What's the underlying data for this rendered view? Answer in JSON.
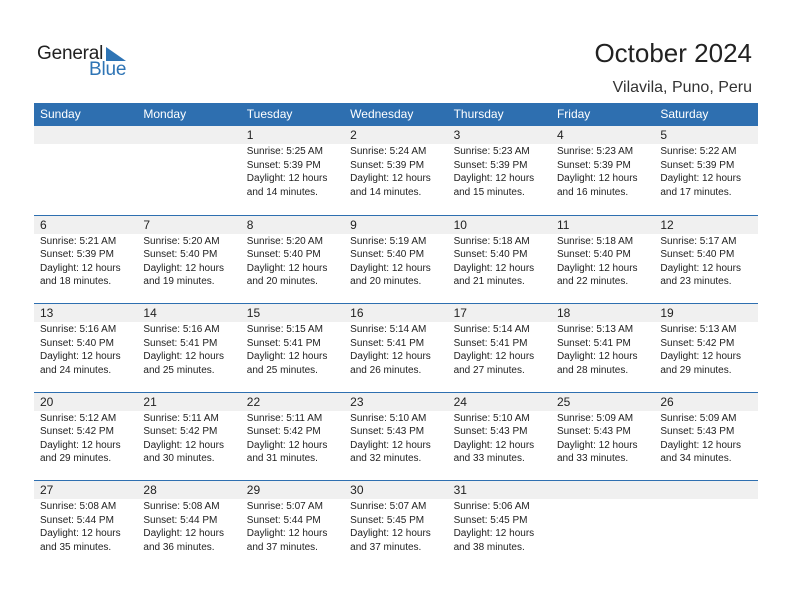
{
  "logo": {
    "line1": "General",
    "line2": "Blue",
    "icon": "triangle-flag-icon",
    "accent_color": "#2e74b5"
  },
  "header": {
    "title": "October 2024",
    "location": "Vilavila, Puno, Peru"
  },
  "colors": {
    "header_bg": "#2e6fb0",
    "day_num_bg": "#f0f0f0"
  },
  "weekdays": [
    "Sunday",
    "Monday",
    "Tuesday",
    "Wednesday",
    "Thursday",
    "Friday",
    "Saturday"
  ],
  "weeks": [
    [
      null,
      null,
      {
        "day": "1",
        "sunrise": "Sunrise: 5:25 AM",
        "sunset": "Sunset: 5:39 PM",
        "daylight1": "Daylight: 12 hours",
        "daylight2": "and 14 minutes."
      },
      {
        "day": "2",
        "sunrise": "Sunrise: 5:24 AM",
        "sunset": "Sunset: 5:39 PM",
        "daylight1": "Daylight: 12 hours",
        "daylight2": "and 14 minutes."
      },
      {
        "day": "3",
        "sunrise": "Sunrise: 5:23 AM",
        "sunset": "Sunset: 5:39 PM",
        "daylight1": "Daylight: 12 hours",
        "daylight2": "and 15 minutes."
      },
      {
        "day": "4",
        "sunrise": "Sunrise: 5:23 AM",
        "sunset": "Sunset: 5:39 PM",
        "daylight1": "Daylight: 12 hours",
        "daylight2": "and 16 minutes."
      },
      {
        "day": "5",
        "sunrise": "Sunrise: 5:22 AM",
        "sunset": "Sunset: 5:39 PM",
        "daylight1": "Daylight: 12 hours",
        "daylight2": "and 17 minutes."
      }
    ],
    [
      {
        "day": "6",
        "sunrise": "Sunrise: 5:21 AM",
        "sunset": "Sunset: 5:39 PM",
        "daylight1": "Daylight: 12 hours",
        "daylight2": "and 18 minutes."
      },
      {
        "day": "7",
        "sunrise": "Sunrise: 5:20 AM",
        "sunset": "Sunset: 5:40 PM",
        "daylight1": "Daylight: 12 hours",
        "daylight2": "and 19 minutes."
      },
      {
        "day": "8",
        "sunrise": "Sunrise: 5:20 AM",
        "sunset": "Sunset: 5:40 PM",
        "daylight1": "Daylight: 12 hours",
        "daylight2": "and 20 minutes."
      },
      {
        "day": "9",
        "sunrise": "Sunrise: 5:19 AM",
        "sunset": "Sunset: 5:40 PM",
        "daylight1": "Daylight: 12 hours",
        "daylight2": "and 20 minutes."
      },
      {
        "day": "10",
        "sunrise": "Sunrise: 5:18 AM",
        "sunset": "Sunset: 5:40 PM",
        "daylight1": "Daylight: 12 hours",
        "daylight2": "and 21 minutes."
      },
      {
        "day": "11",
        "sunrise": "Sunrise: 5:18 AM",
        "sunset": "Sunset: 5:40 PM",
        "daylight1": "Daylight: 12 hours",
        "daylight2": "and 22 minutes."
      },
      {
        "day": "12",
        "sunrise": "Sunrise: 5:17 AM",
        "sunset": "Sunset: 5:40 PM",
        "daylight1": "Daylight: 12 hours",
        "daylight2": "and 23 minutes."
      }
    ],
    [
      {
        "day": "13",
        "sunrise": "Sunrise: 5:16 AM",
        "sunset": "Sunset: 5:40 PM",
        "daylight1": "Daylight: 12 hours",
        "daylight2": "and 24 minutes."
      },
      {
        "day": "14",
        "sunrise": "Sunrise: 5:16 AM",
        "sunset": "Sunset: 5:41 PM",
        "daylight1": "Daylight: 12 hours",
        "daylight2": "and 25 minutes."
      },
      {
        "day": "15",
        "sunrise": "Sunrise: 5:15 AM",
        "sunset": "Sunset: 5:41 PM",
        "daylight1": "Daylight: 12 hours",
        "daylight2": "and 25 minutes."
      },
      {
        "day": "16",
        "sunrise": "Sunrise: 5:14 AM",
        "sunset": "Sunset: 5:41 PM",
        "daylight1": "Daylight: 12 hours",
        "daylight2": "and 26 minutes."
      },
      {
        "day": "17",
        "sunrise": "Sunrise: 5:14 AM",
        "sunset": "Sunset: 5:41 PM",
        "daylight1": "Daylight: 12 hours",
        "daylight2": "and 27 minutes."
      },
      {
        "day": "18",
        "sunrise": "Sunrise: 5:13 AM",
        "sunset": "Sunset: 5:41 PM",
        "daylight1": "Daylight: 12 hours",
        "daylight2": "and 28 minutes."
      },
      {
        "day": "19",
        "sunrise": "Sunrise: 5:13 AM",
        "sunset": "Sunset: 5:42 PM",
        "daylight1": "Daylight: 12 hours",
        "daylight2": "and 29 minutes."
      }
    ],
    [
      {
        "day": "20",
        "sunrise": "Sunrise: 5:12 AM",
        "sunset": "Sunset: 5:42 PM",
        "daylight1": "Daylight: 12 hours",
        "daylight2": "and 29 minutes."
      },
      {
        "day": "21",
        "sunrise": "Sunrise: 5:11 AM",
        "sunset": "Sunset: 5:42 PM",
        "daylight1": "Daylight: 12 hours",
        "daylight2": "and 30 minutes."
      },
      {
        "day": "22",
        "sunrise": "Sunrise: 5:11 AM",
        "sunset": "Sunset: 5:42 PM",
        "daylight1": "Daylight: 12 hours",
        "daylight2": "and 31 minutes."
      },
      {
        "day": "23",
        "sunrise": "Sunrise: 5:10 AM",
        "sunset": "Sunset: 5:43 PM",
        "daylight1": "Daylight: 12 hours",
        "daylight2": "and 32 minutes."
      },
      {
        "day": "24",
        "sunrise": "Sunrise: 5:10 AM",
        "sunset": "Sunset: 5:43 PM",
        "daylight1": "Daylight: 12 hours",
        "daylight2": "and 33 minutes."
      },
      {
        "day": "25",
        "sunrise": "Sunrise: 5:09 AM",
        "sunset": "Sunset: 5:43 PM",
        "daylight1": "Daylight: 12 hours",
        "daylight2": "and 33 minutes."
      },
      {
        "day": "26",
        "sunrise": "Sunrise: 5:09 AM",
        "sunset": "Sunset: 5:43 PM",
        "daylight1": "Daylight: 12 hours",
        "daylight2": "and 34 minutes."
      }
    ],
    [
      {
        "day": "27",
        "sunrise": "Sunrise: 5:08 AM",
        "sunset": "Sunset: 5:44 PM",
        "daylight1": "Daylight: 12 hours",
        "daylight2": "and 35 minutes."
      },
      {
        "day": "28",
        "sunrise": "Sunrise: 5:08 AM",
        "sunset": "Sunset: 5:44 PM",
        "daylight1": "Daylight: 12 hours",
        "daylight2": "and 36 minutes."
      },
      {
        "day": "29",
        "sunrise": "Sunrise: 5:07 AM",
        "sunset": "Sunset: 5:44 PM",
        "daylight1": "Daylight: 12 hours",
        "daylight2": "and 37 minutes."
      },
      {
        "day": "30",
        "sunrise": "Sunrise: 5:07 AM",
        "sunset": "Sunset: 5:45 PM",
        "daylight1": "Daylight: 12 hours",
        "daylight2": "and 37 minutes."
      },
      {
        "day": "31",
        "sunrise": "Sunrise: 5:06 AM",
        "sunset": "Sunset: 5:45 PM",
        "daylight1": "Daylight: 12 hours",
        "daylight2": "and 38 minutes."
      },
      null,
      null
    ]
  ]
}
